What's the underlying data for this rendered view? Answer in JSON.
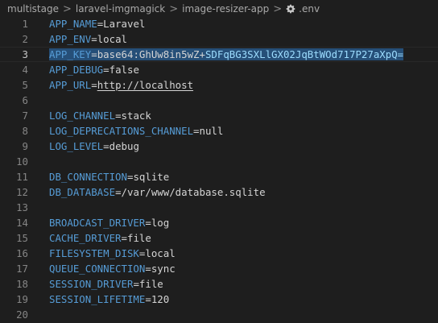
{
  "breadcrumb": {
    "items": [
      "multistage",
      "laravel-imgmagick",
      "image-resizer-app"
    ],
    "file": ".env",
    "separator": ">",
    "file_icon": "gear-icon"
  },
  "colors": {
    "background": "#1e1e1e",
    "key": "#569cd6",
    "value": "#d4d4d4",
    "selection": "#264f78",
    "line_number": "#858585"
  },
  "editor": {
    "current_line": 3,
    "lines": [
      {
        "num": "1",
        "key": "APP_NAME",
        "eq": "=",
        "value": "Laravel"
      },
      {
        "num": "2",
        "key": "APP_ENV",
        "eq": "=",
        "value": "local"
      },
      {
        "num": "3",
        "key": "APP_KEY",
        "eq": "=",
        "value": "base64:GhUw8in5wZ+SDFqBG3SXLlGX02JqBtWOd717P27aXpQ="
      },
      {
        "num": "4",
        "key": "APP_DEBUG",
        "eq": "=",
        "value": "false"
      },
      {
        "num": "5",
        "key": "APP_URL",
        "eq": "=",
        "value": "http://localhost"
      },
      {
        "num": "6",
        "key": "",
        "eq": "",
        "value": ""
      },
      {
        "num": "7",
        "key": "LOG_CHANNEL",
        "eq": "=",
        "value": "stack"
      },
      {
        "num": "8",
        "key": "LOG_DEPRECATIONS_CHANNEL",
        "eq": "=",
        "value": "null"
      },
      {
        "num": "9",
        "key": "LOG_LEVEL",
        "eq": "=",
        "value": "debug"
      },
      {
        "num": "10",
        "key": "",
        "eq": "",
        "value": ""
      },
      {
        "num": "11",
        "key": "DB_CONNECTION",
        "eq": "=",
        "value": "sqlite"
      },
      {
        "num": "12",
        "key": "DB_DATABASE",
        "eq": "=",
        "value": "/var/www/database.sqlite"
      },
      {
        "num": "13",
        "key": "",
        "eq": "",
        "value": ""
      },
      {
        "num": "14",
        "key": "BROADCAST_DRIVER",
        "eq": "=",
        "value": "log"
      },
      {
        "num": "15",
        "key": "CACHE_DRIVER",
        "eq": "=",
        "value": "file"
      },
      {
        "num": "16",
        "key": "FILESYSTEM_DISK",
        "eq": "=",
        "value": "local"
      },
      {
        "num": "17",
        "key": "QUEUE_CONNECTION",
        "eq": "=",
        "value": "sync"
      },
      {
        "num": "18",
        "key": "SESSION_DRIVER",
        "eq": "=",
        "value": "file"
      },
      {
        "num": "19",
        "key": "SESSION_LIFETIME",
        "eq": "=",
        "value": "120"
      },
      {
        "num": "20",
        "key": "",
        "eq": "",
        "value": ""
      }
    ]
  }
}
